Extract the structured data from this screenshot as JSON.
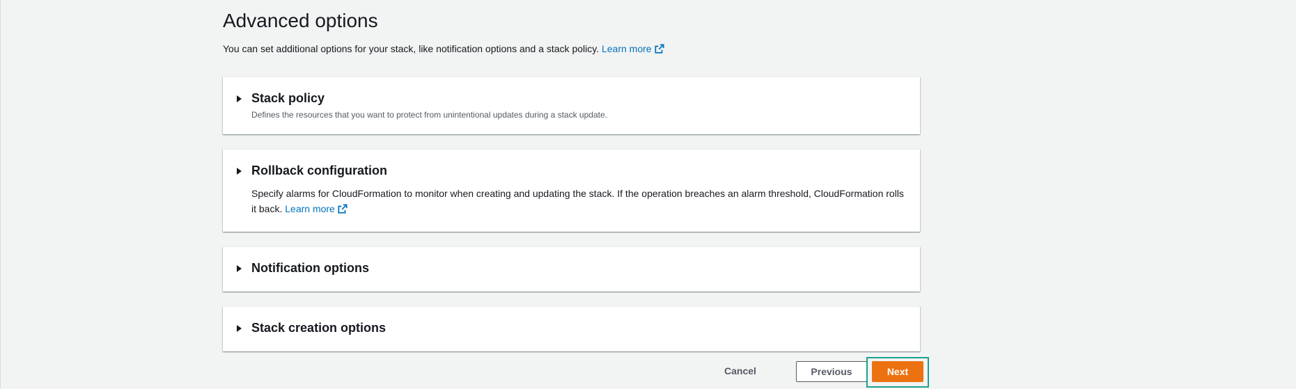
{
  "page": {
    "title": "Advanced options",
    "description": "You can set additional options for your stack, like notification options and a stack policy.",
    "learn_more": "Learn more"
  },
  "panels": [
    {
      "title": "Stack policy",
      "description": "Defines the resources that you want to protect from unintentional updates during a stack update."
    },
    {
      "title": "Rollback configuration",
      "description": "Specify alarms for CloudFormation to monitor when creating and updating the stack. If the operation breaches an alarm threshold, CloudFormation rolls it back.",
      "learn_more": "Learn more"
    },
    {
      "title": "Notification options"
    },
    {
      "title": "Stack creation options"
    }
  ],
  "footer": {
    "cancel_label": "Cancel",
    "previous_label": "Previous",
    "next_label": "Next"
  },
  "colors": {
    "link": "#0073bb",
    "primary_button": "#ec7211",
    "highlight_border": "#1aa38b",
    "background": "#f2f3f3"
  },
  "icons": {
    "panel_toggle": "caret-right-icon",
    "external_link": "external-link-icon"
  }
}
